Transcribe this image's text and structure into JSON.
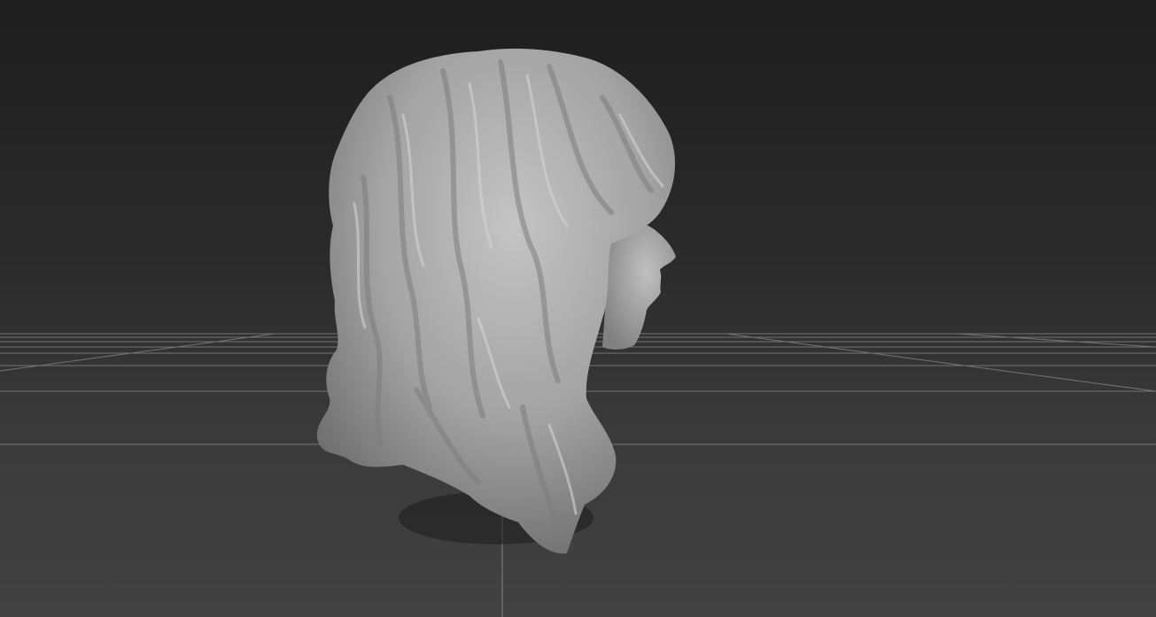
{
  "viewport": {
    "background_top": "#1e1e1e",
    "background_bottom": "#424242",
    "grid_color": "#8a8a8a",
    "model_color": "#a9a9a9"
  },
  "scene": {
    "object": "sculpted-head-with-wavy-hair",
    "view": "perspective"
  }
}
